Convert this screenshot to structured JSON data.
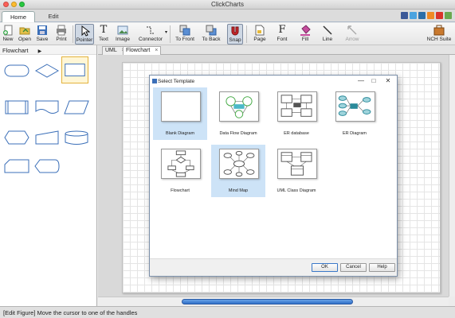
{
  "window": {
    "title": "ClickCharts"
  },
  "ribbon_tabs": [
    {
      "label": "Home"
    },
    {
      "label": "Edit"
    }
  ],
  "toolbar": {
    "new": "New",
    "open": "Open",
    "save": "Save",
    "print": "Print",
    "pointer": "Pointer",
    "text": "Text",
    "image": "Image",
    "connector": "Connector",
    "to_front": "To Front",
    "to_back": "To Back",
    "snap": "Snap",
    "page": "Page",
    "font": "Font",
    "fill": "Fill",
    "line": "Line",
    "arrow": "Arrow",
    "nch_suite": "NCH Suite"
  },
  "left_panel": {
    "category": "Flowchart",
    "arrow": "▶"
  },
  "doc_tabs": [
    {
      "label": "UML",
      "close": "×"
    },
    {
      "label": "Flowchart",
      "close": "×"
    }
  ],
  "dialog": {
    "title": "Select Template",
    "minimize": "—",
    "maximize": "□",
    "close": "✕",
    "templates": [
      {
        "label": "Blank Diagram"
      },
      {
        "label": "Data Flow Diagram"
      },
      {
        "label": "ER database"
      },
      {
        "label": "ER Diagram"
      },
      {
        "label": "Flowchart"
      },
      {
        "label": "Mind Map"
      },
      {
        "label": "UML Class Diagram"
      }
    ],
    "ok": "OK",
    "cancel": "Cancel",
    "help": "Help"
  },
  "status_bar": {
    "text": "[Edit Figure] Move the cursor to one of the handles"
  },
  "colors": {
    "accent": "#2f6fc8",
    "selection": "#cde3f7",
    "shape_stroke": "#3b6fb8"
  }
}
